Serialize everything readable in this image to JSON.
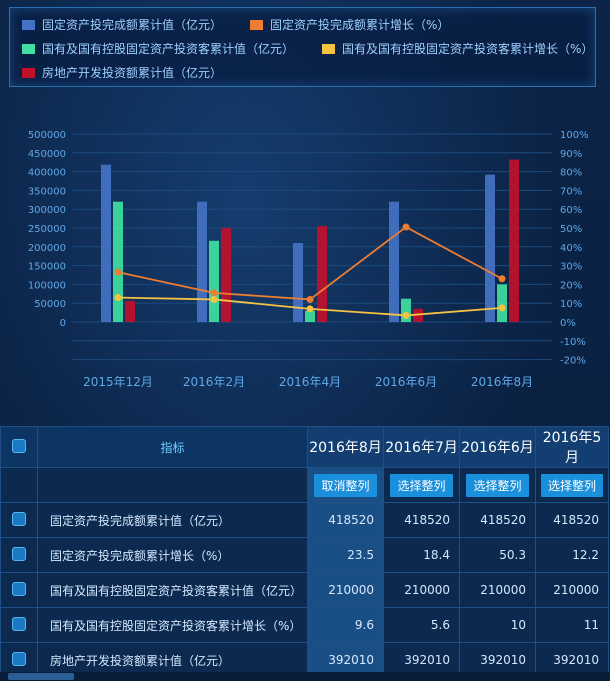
{
  "legend": [
    {
      "label": "固定资产投完成额累计值（亿元）",
      "color": "#4472c4"
    },
    {
      "label": "固定资产投完成额累计增长（%）",
      "color": "#ed7d31"
    },
    {
      "label": "国有及国有控股固定资产投资客累计值（亿元）",
      "color": "#3fe0a0"
    },
    {
      "label": "国有及国有控股固定资产投资客累计增长（%）",
      "color": "#f5c242"
    },
    {
      "label": "房地产开发投资额累计值（亿元）",
      "color": "#c0102a"
    }
  ],
  "chart_data": {
    "type": "bar",
    "categories": [
      "2015年12月",
      "2016年2月",
      "2016年4月",
      "2016年6月",
      "2016年8月"
    ],
    "y_left": {
      "min": 0,
      "max": 500000,
      "ticks": [
        0,
        50000,
        100000,
        150000,
        200000,
        250000,
        300000,
        350000,
        400000,
        450000,
        500000
      ]
    },
    "y_right": {
      "min": -20,
      "max": 100,
      "ticks": [
        -20,
        -10,
        0,
        10,
        20,
        30,
        40,
        50,
        60,
        70,
        80,
        90,
        100
      ],
      "unit": "%"
    },
    "series": [
      {
        "name": "固定资产投完成额累计值（亿元）",
        "kind": "bar",
        "axis": "left",
        "color": "#4472c4",
        "values": [
          418520,
          320000,
          210000,
          320000,
          392010
        ]
      },
      {
        "name": "国有及国有控股固定资产投资客累计值（亿元）",
        "kind": "bar",
        "axis": "left",
        "color": "#3fe0a0",
        "values": [
          320000,
          216000,
          30000,
          62000,
          100000
        ]
      },
      {
        "name": "房地产开发投资额累计值（亿元）",
        "kind": "bar",
        "axis": "left",
        "color": "#c0102a",
        "values": [
          56000,
          250000,
          255000,
          35000,
          432000
        ]
      },
      {
        "name": "固定资产投完成额累计增长（%）",
        "kind": "line",
        "axis": "right",
        "color": "#ed7d31",
        "values": [
          26.5,
          15.5,
          12,
          50.5,
          23
        ]
      },
      {
        "name": "国有及国有控股固定资产投资客累计增长（%）",
        "kind": "line",
        "axis": "right",
        "color": "#f5c242",
        "values": [
          13,
          12,
          7,
          3.5,
          7.5
        ]
      }
    ]
  },
  "table": {
    "header_label": "指标",
    "months": [
      "2016年8月",
      "2016年7月",
      "2016年6月",
      "2016年5月"
    ],
    "buttons": [
      "取消整列",
      "选择整列",
      "选择整列",
      "选择整列"
    ],
    "rows": [
      {
        "name": "固定资产投完成额累计值（亿元）",
        "values": [
          "418520",
          "418520",
          "418520",
          "418520"
        ]
      },
      {
        "name": "固定资产投完成额累计增长（%）",
        "values": [
          "23.5",
          "18.4",
          "50.3",
          "12.2"
        ]
      },
      {
        "name": "国有及国有控股固定资产投资客累计值（亿元）",
        "values": [
          "210000",
          "210000",
          "210000",
          "210000"
        ]
      },
      {
        "name": "国有及国有控股固定资产投资客累计增长（%）",
        "values": [
          "9.6",
          "5.6",
          "10",
          "11"
        ]
      },
      {
        "name": "房地产开发投资额累计值（亿元）",
        "values": [
          "392010",
          "392010",
          "392010",
          "392010"
        ]
      }
    ]
  }
}
